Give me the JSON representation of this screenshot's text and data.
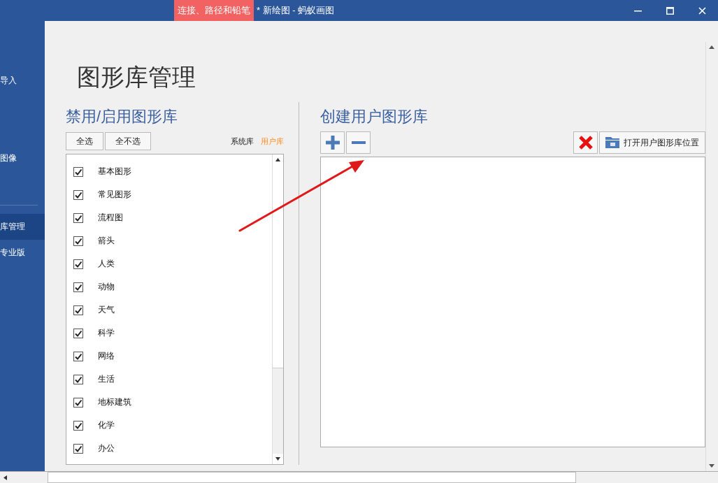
{
  "window": {
    "ribbon_tab": "连接、路径和铅笔",
    "title": "* 新绘图 - 蚂蚁画图"
  },
  "sidebar": {
    "items": [
      {
        "label": "导入",
        "selected": false
      },
      {
        "label": "图像",
        "selected": false
      },
      {
        "label": "库管理",
        "selected": true
      },
      {
        "label": "专业版",
        "selected": false
      }
    ]
  },
  "page_title": "图形库管理",
  "left_panel": {
    "heading": "禁用/启用图形库",
    "buttons": [
      "全选",
      "全不选"
    ],
    "filters": [
      {
        "label": "系统库",
        "selected": true
      },
      {
        "label": "用户库",
        "selected": false
      }
    ],
    "libraries": [
      {
        "label": "基本图形",
        "checked": true
      },
      {
        "label": "常见图形",
        "checked": true
      },
      {
        "label": "流程图",
        "checked": true
      },
      {
        "label": "箭头",
        "checked": true
      },
      {
        "label": "人类",
        "checked": true
      },
      {
        "label": "动物",
        "checked": true
      },
      {
        "label": "天气",
        "checked": true
      },
      {
        "label": "科学",
        "checked": true
      },
      {
        "label": "网络",
        "checked": true
      },
      {
        "label": "生活",
        "checked": true
      },
      {
        "label": "地标建筑",
        "checked": true
      },
      {
        "label": "化学",
        "checked": true
      },
      {
        "label": "办公",
        "checked": true
      }
    ]
  },
  "right_panel": {
    "heading": "创建用户图形库",
    "open_location_button": "打开用户图形库位置"
  }
}
